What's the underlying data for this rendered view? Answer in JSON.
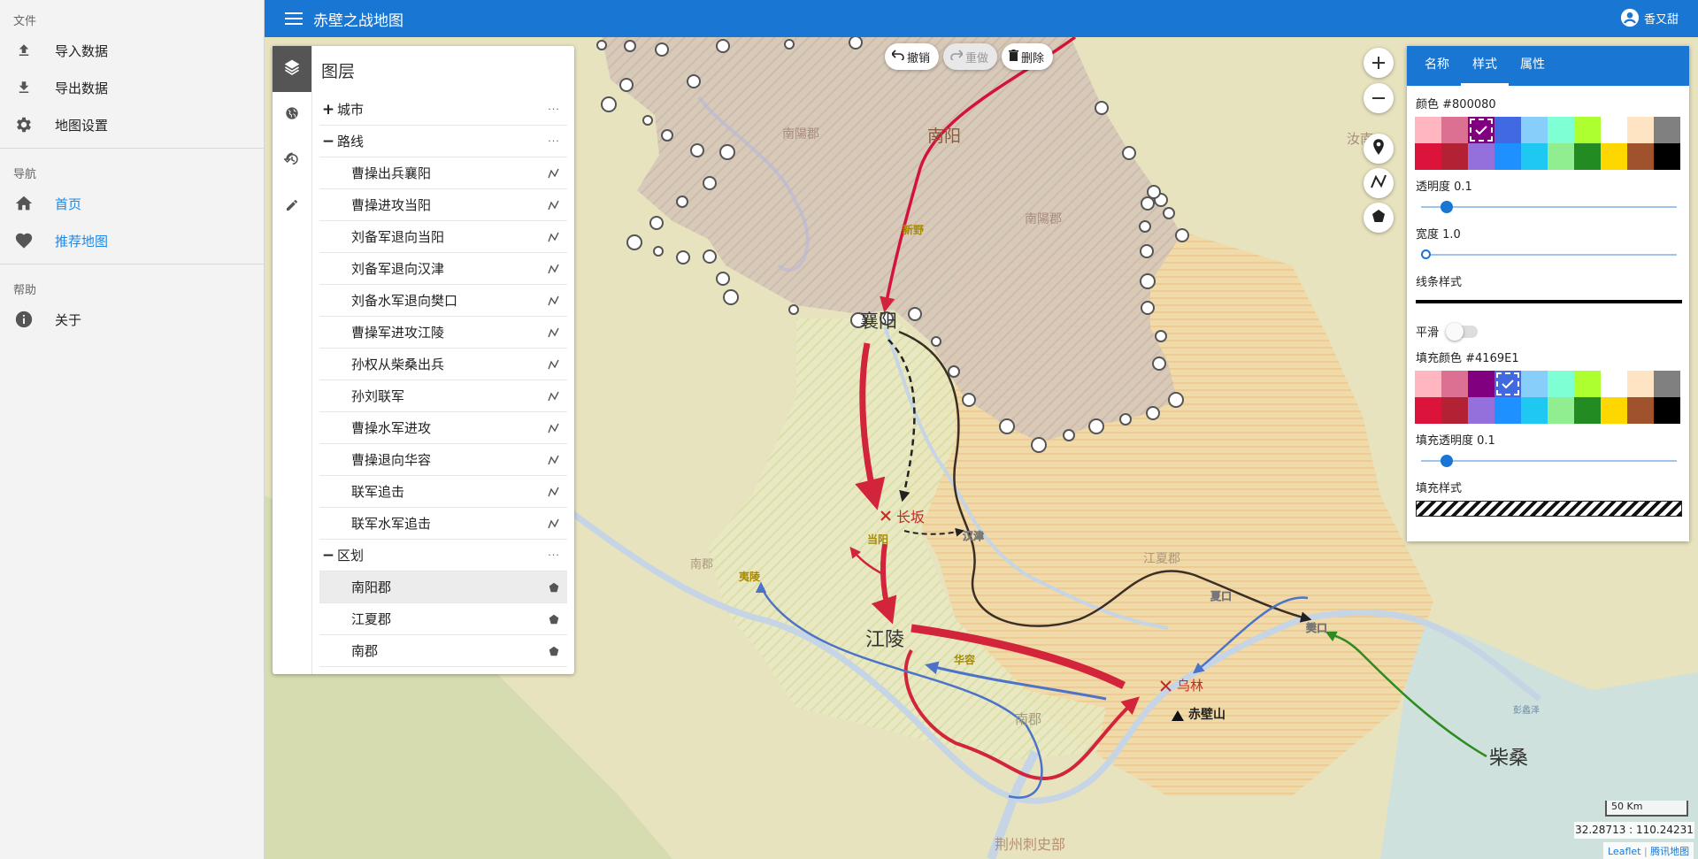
{
  "drawer": {
    "file_section": "文件",
    "file_items": [
      "导入数据",
      "导出数据",
      "地图设置"
    ],
    "nav_section": "导航",
    "nav_items": [
      "首页",
      "推荐地图"
    ],
    "help_section": "帮助",
    "help_items": [
      "关于"
    ]
  },
  "appbar": {
    "title": "赤壁之战地图",
    "user": "香又甜"
  },
  "toolbar": {
    "undo": "撤销",
    "redo": "重做",
    "delete": "删除"
  },
  "layers": {
    "title": "图层",
    "groups": [
      {
        "label": "城市",
        "sign": "+"
      },
      {
        "label": "路线",
        "sign": "−"
      },
      {
        "label": "区划",
        "sign": "−"
      }
    ],
    "routes": [
      "曹操出兵襄阳",
      "曹操进攻当阳",
      "刘备军退向当阳",
      "刘备军退向汉津",
      "刘备水军退向樊口",
      "曹操军进攻江陵",
      "孙权从柴桑出兵",
      "孙刘联军",
      "曹操水军进攻",
      "曹操退向华容",
      "联军追击",
      "联军水军追击"
    ],
    "regions": [
      "南阳郡",
      "江夏郡",
      "南郡"
    ],
    "selected_region": "南阳郡",
    "more": "···"
  },
  "style_panel": {
    "tabs": [
      "名称",
      "样式",
      "属性"
    ],
    "active_tab": "样式",
    "color_label": "颜色 #800080",
    "opacity_label": "透明度 0.1",
    "opacity_value": 0.1,
    "width_label": "宽度 1.0",
    "width_value": 1.0,
    "line_style_label": "线条样式",
    "smooth_label": "平滑",
    "fill_color_label": "填充颜色 #4169E1",
    "fill_opacity_label": "填充透明度 0.1",
    "fill_opacity_value": 0.1,
    "fill_style_label": "填充样式",
    "palette": [
      "#ffb6c1",
      "#db7093",
      "#800080",
      "#4169e1",
      "#87cefa",
      "#7fffd4",
      "#adff2f",
      "#ffffff",
      "#ffe4c4",
      "#808080",
      "#dc143c",
      "#b22234",
      "#9370db",
      "#1e90ff",
      "#1ec8f0",
      "#90ee90",
      "#228b22",
      "#ffd700",
      "#a0522d",
      "#000000"
    ],
    "selected_color": "#800080",
    "selected_fill": "#4169e1"
  },
  "map": {
    "labels": {
      "nanyang_big": "南阳",
      "nanyang_jun1": "南陽郡",
      "nanyang_jun2": "南陽郡",
      "ru": "汝南",
      "xiangyang": "襄阳",
      "xinye": "新野",
      "changban": "长坂",
      "dangyang": "当阳",
      "hanjin": "汉津",
      "jiangling": "江陵",
      "yiling": "夷陵",
      "nanjun_w": "南郡",
      "huarong": "华容",
      "jiangxia": "江夏郡",
      "xiakou": "夏口",
      "fankou": "樊口",
      "wulin": "乌林",
      "chibi": "赤壁山",
      "nanjun": "南郡",
      "chaisang": "柴桑",
      "jingzhou": "荆州刺史部",
      "pengli": "彭蠡泽"
    },
    "scale": "50 Km",
    "coords": "32.28713 : 110.24231",
    "attribution": [
      "Leaflet",
      "腾讯地图"
    ]
  }
}
